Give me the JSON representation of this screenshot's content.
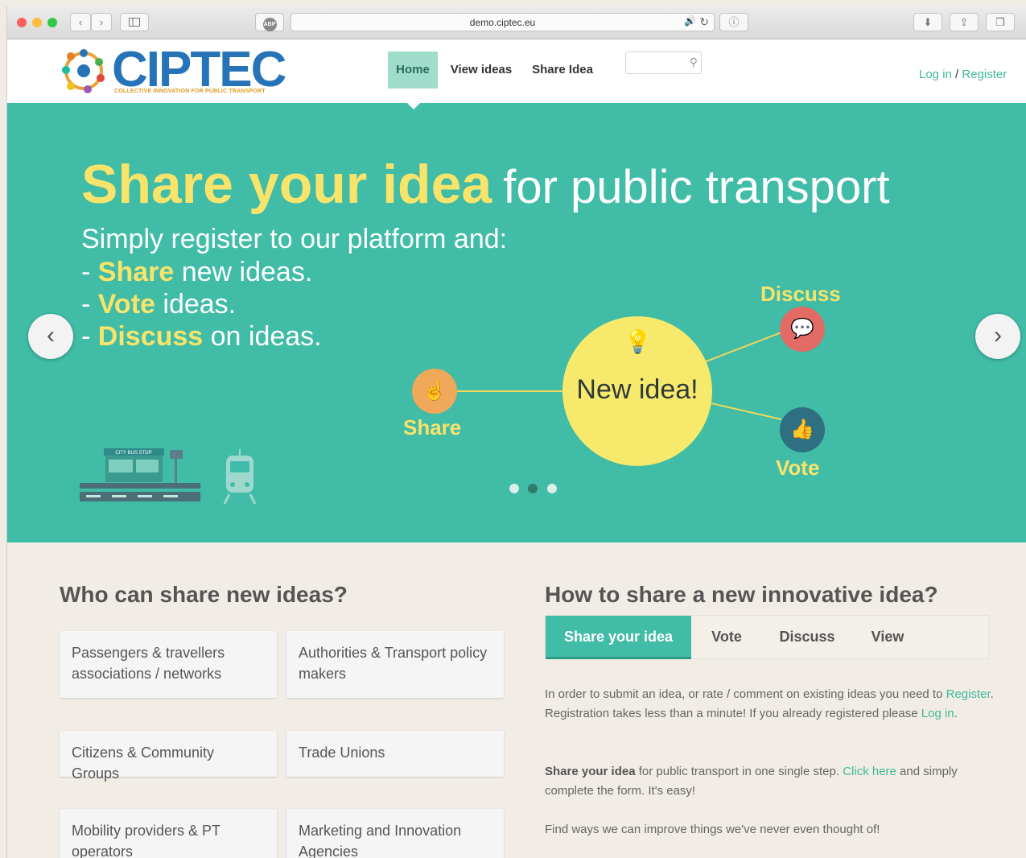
{
  "browser": {
    "url": "demo.ciptec.eu",
    "adblock_label": "ABP"
  },
  "header": {
    "logo_text": "CIPTEC",
    "logo_tagline": "COLLECTIVE INNOVATION FOR PUBLIC TRANSPORT",
    "nav": [
      "Home",
      "View ideas",
      "Share Idea"
    ],
    "login": "Log in",
    "slash": " / ",
    "register": "Register"
  },
  "hero": {
    "headline_bold": "Share your idea",
    "headline_rest": "for public transport",
    "intro": "Simply register to our platform and:",
    "bullets": [
      {
        "prefix": "- ",
        "key": "Share",
        "rest": " new ideas."
      },
      {
        "prefix": "- ",
        "key": "Vote",
        "rest": " ideas."
      },
      {
        "prefix": "- ",
        "key": "Discuss",
        "rest": " on ideas."
      }
    ],
    "center": "New idea!",
    "share_label": "Share",
    "discuss_label": "Discuss",
    "vote_label": "Vote",
    "bus_stop_sign": "CITY BUS STOP",
    "slides_total": 3,
    "slide_active": 2
  },
  "who": {
    "title": "Who can share new ideas?",
    "cards": [
      "Passengers & travellers associations / networks",
      "Authorities & Transport policy makers",
      "Citizens & Community Groups",
      "Trade Unions",
      "Mobility providers & PT operators",
      "Marketing and Innovation Agencies"
    ]
  },
  "how": {
    "title": "How to share a new innovative idea?",
    "tabs": [
      "Share your idea",
      "Vote",
      "Discuss",
      "View"
    ],
    "p1_a": "In order to submit an idea, or rate / comment on existing ideas you need to ",
    "p1_link1": "Register",
    "p1_b": ". Registration takes less than a minute! If you already registered please ",
    "p1_link2": "Log in",
    "p1_c": ".",
    "p2_bold": "Share your idea",
    "p2_a": " for public transport in one single step. ",
    "p2_link": "Click here",
    "p2_b": " and simply complete the form. It's easy!",
    "p3": "Find ways we can improve things we've never even thought of!"
  },
  "colors": {
    "teal": "#40bca7",
    "yellow": "#f8e46b",
    "logo_blue": "#2673b8"
  }
}
